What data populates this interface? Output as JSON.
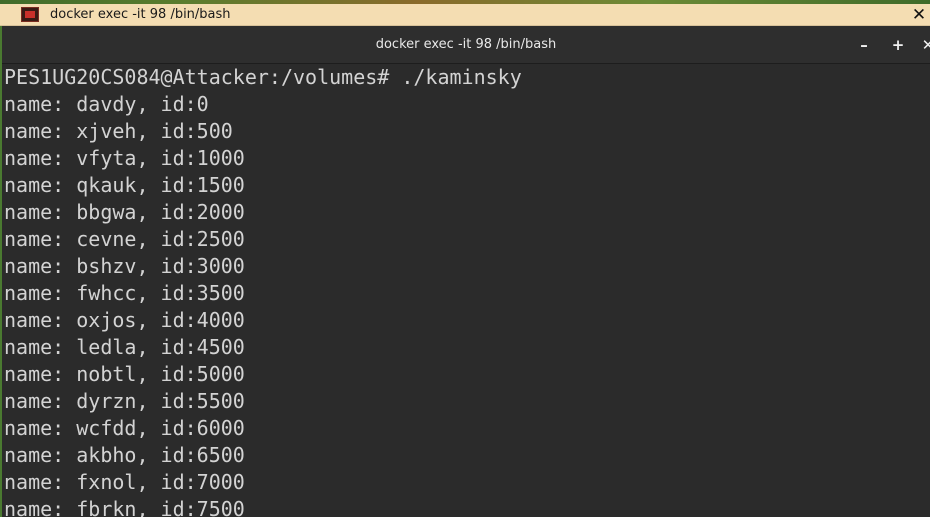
{
  "outer_window": {
    "title": "docker exec -it 98 /bin/bash",
    "icon": "terminal-app-icon",
    "close_glyph": "✕"
  },
  "terminal": {
    "title": "docker exec -it 98 /bin/bash",
    "buttons": {
      "minimize": "–",
      "maximize": "+",
      "close": "✕"
    },
    "prompt_line": "PES1UG20CS084@Attacker:/volumes# ./kaminsky",
    "output_lines": [
      "name: davdy, id:0",
      "name: xjveh, id:500",
      "name: vfyta, id:1000",
      "name: qkauk, id:1500",
      "name: bbgwa, id:2000",
      "name: cevne, id:2500",
      "name: bshzv, id:3000",
      "name: fwhcc, id:3500",
      "name: oxjos, id:4000",
      "name: ledla, id:4500",
      "name: nobtl, id:5000",
      "name: dyrzn, id:5500",
      "name: wcfdd, id:6000",
      "name: akbho, id:6500",
      "name: fxnol, id:7000",
      "name: fbrkn, id:7500"
    ]
  },
  "colors": {
    "outer_titlebar": "#f4ddb2",
    "terminal_background": "#2b2b2b",
    "terminal_text": "#d3d3d3"
  }
}
